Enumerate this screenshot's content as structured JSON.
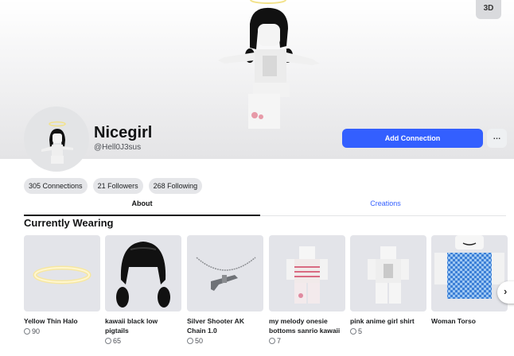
{
  "header": {
    "view_3d_label": "3D"
  },
  "profile": {
    "display_name": "Nicegirl",
    "username": "@Hell0J3sus",
    "add_connection_label": "Add Connection",
    "more_label": "…",
    "stats": [
      {
        "label": "305 Connections"
      },
      {
        "label": "21 Followers"
      },
      {
        "label": "268 Following"
      }
    ]
  },
  "tabs": [
    {
      "label": "About",
      "active": true
    },
    {
      "label": "Creations",
      "active": false
    }
  ],
  "currently_wearing": {
    "title": "Currently Wearing",
    "items": [
      {
        "name": "Yellow Thin Halo",
        "price": "90",
        "icon": "halo-icon"
      },
      {
        "name": "kawaii black low pigtails",
        "price": "65",
        "icon": "hair-icon"
      },
      {
        "name": "Silver Shooter AK Chain 1.0",
        "price": "50",
        "icon": "chain-icon"
      },
      {
        "name": "my melody onesie bottoms sanrio kawaii",
        "price": "7",
        "icon": "pants-icon"
      },
      {
        "name": "pink anime girl shirt",
        "price": "5",
        "icon": "shirt-icon"
      },
      {
        "name": "Woman Torso",
        "price": "",
        "icon": "torso-icon"
      }
    ],
    "next_label": "›"
  },
  "colors": {
    "accent": "#335fff",
    "pill_bg": "#e5e6e9",
    "thumb_bg": "#e3e4e9"
  }
}
